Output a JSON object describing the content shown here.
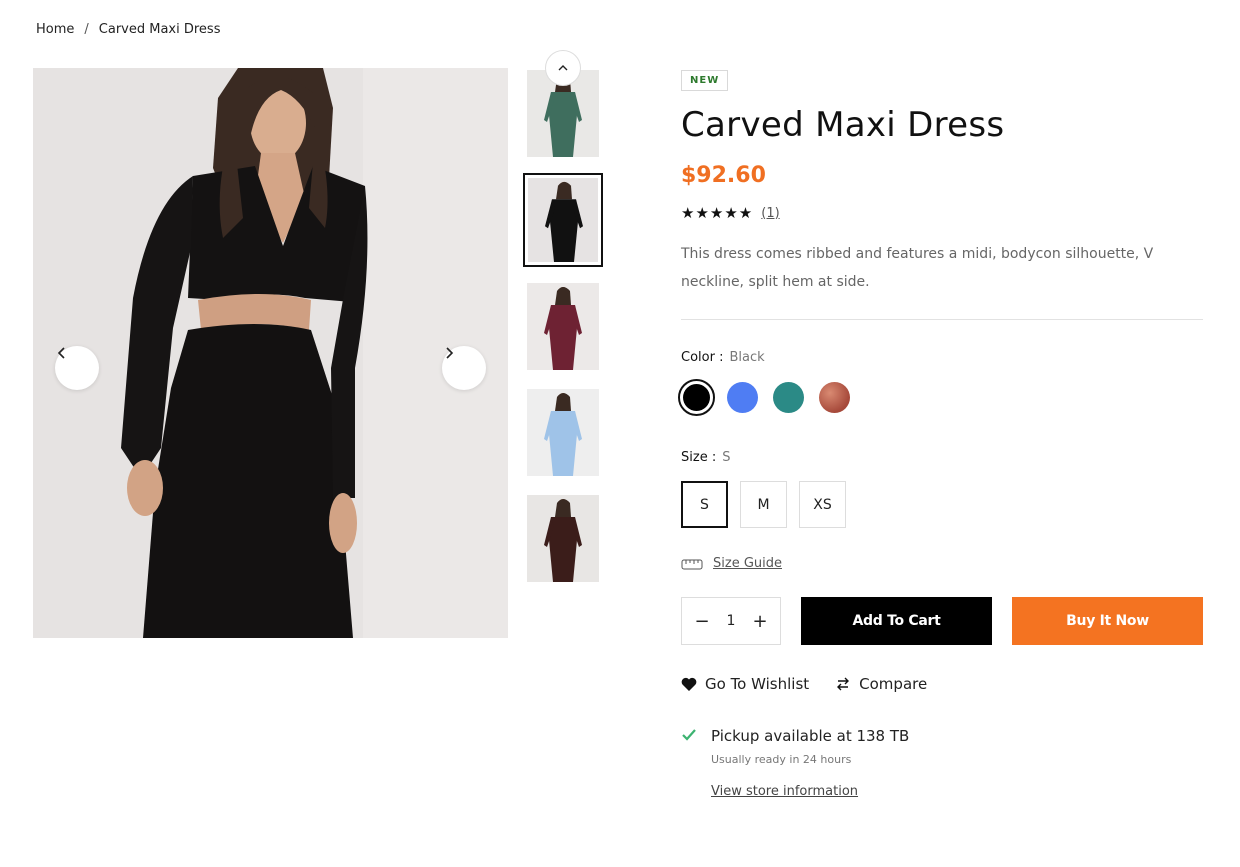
{
  "breadcrumb": {
    "home": "Home",
    "separator": "/",
    "current": "Carved Maxi Dress"
  },
  "product": {
    "badge": "NEW",
    "title": "Carved Maxi Dress",
    "price": "$92.60",
    "stars": "★★★★★",
    "review_count": "(1)",
    "description": "This dress comes ribbed and features a midi, bodycon silhouette, V neckline, split hem at side."
  },
  "color": {
    "label": "Color :",
    "selected": "Black",
    "swatches": [
      "#000000",
      "#4f7df3",
      "#2b8a86",
      "#a6493a"
    ]
  },
  "size": {
    "label": "Size :",
    "selected": "S",
    "options": [
      "S",
      "M",
      "XS"
    ]
  },
  "size_guide": "Size Guide",
  "quantity": {
    "value": "1",
    "minus": "−",
    "plus": "+"
  },
  "buttons": {
    "add_to_cart": "Add To Cart",
    "buy_now": "Buy It Now"
  },
  "links": {
    "wishlist": "Go To Wishlist",
    "compare": "Compare"
  },
  "pickup": {
    "main": "Pickup available at 138 TB",
    "sub": "Usually ready in 24 hours",
    "store_link": "View store information"
  },
  "colors": {
    "accent": "#f06f22",
    "buy_button": "#f47321",
    "check": "#3cb371"
  },
  "icons": {
    "gallery_prev": "chevron-left-icon",
    "gallery_next": "chevron-right-icon",
    "thumbs_up": "chevron-up-icon",
    "size_guide": "ruler-icon",
    "wishlist": "heart-icon",
    "compare": "compare-arrows-icon",
    "pickup": "check-icon"
  },
  "thumbnails": [
    {
      "dress": "#3f6e5e",
      "skin": "#c99a7d",
      "bg": "#e9e8e6"
    },
    {
      "dress": "#111111",
      "skin": "#d3a98c",
      "bg": "#e6e3e3"
    },
    {
      "dress": "#6e2233",
      "skin": "#6b4433",
      "bg": "#ece9e8"
    },
    {
      "dress": "#9fc3e8",
      "skin": "#d7b59c",
      "bg": "#eeeeee"
    },
    {
      "dress": "#3b1d1a",
      "skin": "#c69a7d",
      "bg": "#e8e6e4"
    }
  ]
}
